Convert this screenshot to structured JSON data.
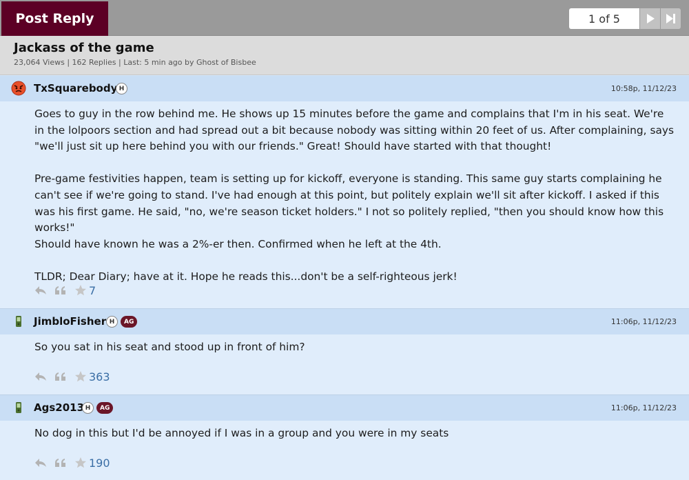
{
  "toolbar": {
    "post_reply_label": "Post Reply"
  },
  "pager": {
    "label": "1 of 5"
  },
  "thread": {
    "title": "Jackass of the game",
    "meta": "23,064 Views | 162 Replies | Last: 5 min ago by Ghost of Bisbee"
  },
  "colors": {
    "brand": "#5c0025",
    "post_header": "#c9def5",
    "post_body": "#e0edfb",
    "link": "#3a6ea5"
  },
  "posts": [
    {
      "username": "TxSquarebody",
      "badges": [
        "H"
      ],
      "timestamp": "10:58p, 11/12/23",
      "avatar_icon": "angry-face-icon",
      "paragraphs": [
        "Goes to guy in the row behind me. He shows up 15 minutes before the game and complains that I'm in his seat. We're in the lolpoors section and had spread out a bit because nobody was sitting within 20 feet of us. After complaining, says \"we'll just sit up here behind you with our friends.\" Great! Should have started with that thought!",
        "Pre-game festivities happen, team is setting up for kickoff, everyone is standing. This same guy starts complaining he can't see if we're going to stand. I've had enough at this point, but politely explain we'll sit after kickoff. I asked if this was his first game. He said, \"no, we're season ticket holders.\" I not so politely replied, \"then you should know how this works!\"\nShould have known he was a 2%-er then. Confirmed when he left at the 4th.",
        "TLDR; Dear Diary; have at it. Hope he reads this...don't be a self-righteous jerk!"
      ],
      "likes": "7"
    },
    {
      "username": "JimbloFisher",
      "badges": [
        "H",
        "AG"
      ],
      "timestamp": "11:06p, 11/12/23",
      "avatar_icon": "mobile-phone-icon",
      "paragraphs": [
        "So you sat in his seat and stood up in front of him?"
      ],
      "likes": "363"
    },
    {
      "username": "Ags2013",
      "badges": [
        "H",
        "AG"
      ],
      "timestamp": "11:06p, 11/12/23",
      "avatar_icon": "mobile-phone-icon",
      "paragraphs": [
        "No dog in this but I'd be annoyed if I was in a group and you were in my seats"
      ],
      "likes": "190"
    }
  ]
}
